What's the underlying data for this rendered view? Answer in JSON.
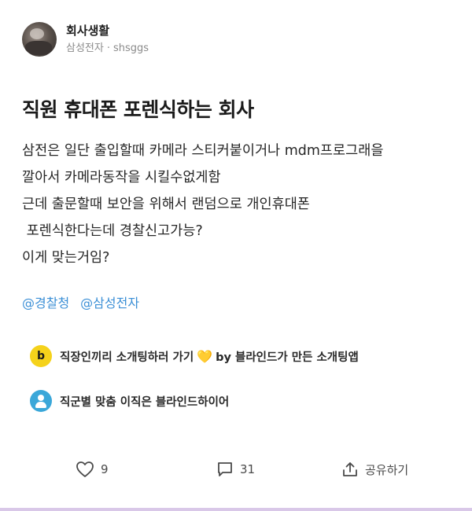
{
  "header": {
    "channel": "회사생활",
    "company": "삼성전자",
    "separator": "·",
    "username": "shsggs"
  },
  "post": {
    "title": "직원 휴대폰 포렌식하는 회사",
    "body": "삼전은 일단 출입할때 카메라 스티커붙이거나 mdm프로그래을\n깔아서 카메라동작을 시킬수없게함\n근데 출문할때 보안을 위해서 랜덤으로 개인휴대폰\n 포렌식한다는데 경찰신고가능?\n이게 맞는거임?",
    "tags": [
      "@경찰청",
      "@삼성전자"
    ]
  },
  "promos": [
    {
      "icon": "blind-b-icon",
      "text": "직장인끼리 소개팅하러 가기",
      "emoji": "💛",
      "suffix": "by 블라인드가 만든 소개팅앱"
    },
    {
      "icon": "person-icon",
      "text": "직군별 맞춤 이직은 블라인드하이어"
    }
  ],
  "actions": {
    "likes": "9",
    "comments": "31",
    "share": "공유하기"
  },
  "colors": {
    "tag": "#3b8fd6",
    "promo_b_icon": "#f5d21b",
    "promo_person_icon": "#3aa7d9"
  }
}
